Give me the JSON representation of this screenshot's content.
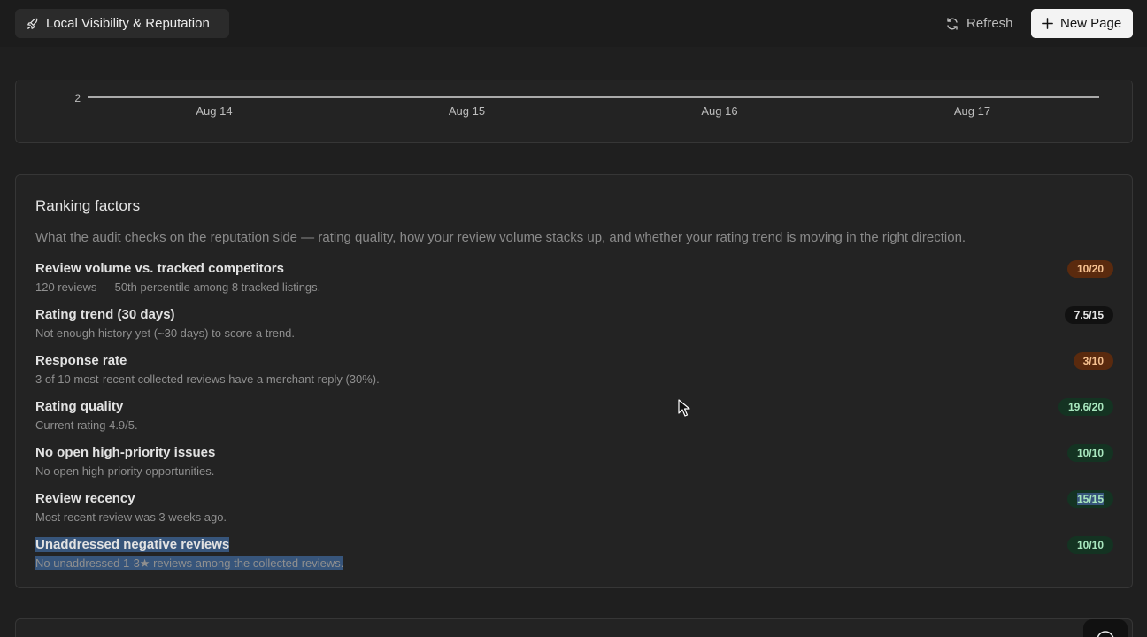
{
  "topbar": {
    "tab_label": "Local Visibility & Reputation",
    "refresh_label": "Refresh",
    "new_page_label": "New Page"
  },
  "page": {
    "title": "Local Visibility & Reputation"
  },
  "chart_data": {
    "type": "line",
    "y_tick_visible": "2",
    "x_ticks": [
      "Aug 14",
      "Aug 15",
      "Aug 16",
      "Aug 17"
    ]
  },
  "ranking": {
    "title": "Ranking factors",
    "description": "What the audit checks on the reputation side — rating quality, how your review volume stacks up, and whether your rating trend is moving in the right direction.",
    "factors": [
      {
        "title": "Review volume vs. tracked competitors",
        "subtitle": "120 reviews — 50th percentile among 8 tracked listings.",
        "score": "10/20",
        "status": "orange"
      },
      {
        "title": "Rating trend (30 days)",
        "subtitle": "Not enough history yet (~30 days) to score a trend.",
        "score": "7.5/15",
        "status": "dark"
      },
      {
        "title": "Response rate",
        "subtitle": "3 of 10 most-recent collected reviews have a merchant reply (30%).",
        "score": "3/10",
        "status": "orange"
      },
      {
        "title": "Rating quality",
        "subtitle": "Current rating 4.9/5.",
        "score": "19.6/20",
        "status": "green"
      },
      {
        "title": "No open high-priority issues",
        "subtitle": "No open high-priority opportunities.",
        "score": "10/10",
        "status": "green"
      },
      {
        "title": "Review recency",
        "subtitle": "Most recent review was 3 weeks ago.",
        "score": "15/15",
        "status": "green"
      },
      {
        "title": "Unaddressed negative reviews",
        "subtitle": "No unaddressed 1-3★ reviews among the collected reviews.",
        "score": "10/10",
        "status": "green"
      }
    ]
  },
  "colors": {
    "background": "#1f1f1f",
    "card": "#232323",
    "badge_orange": "#5a2a0e",
    "badge_green": "#143322",
    "badge_dark": "#111111",
    "selection": "#37557b"
  }
}
